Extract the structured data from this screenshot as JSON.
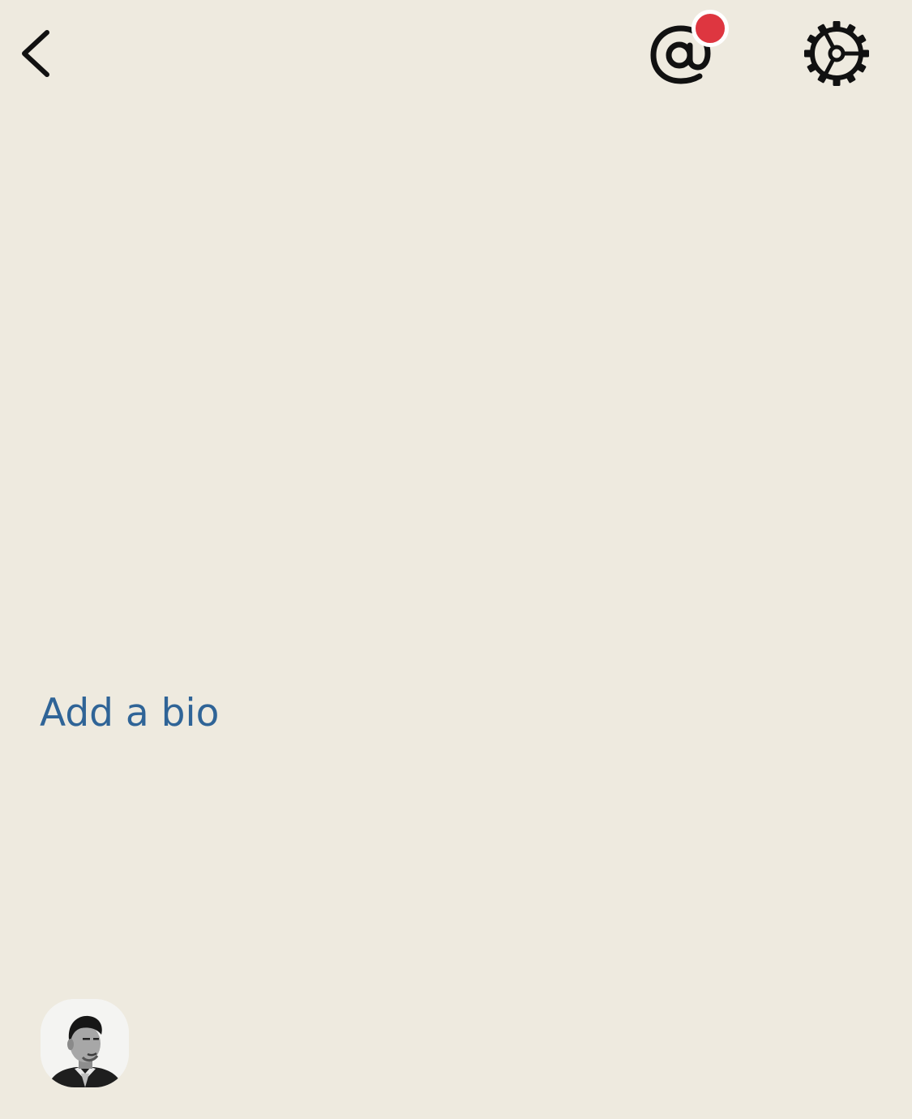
{
  "header": {
    "back_icon": "chevron-left-icon",
    "mentions_icon": "at-sign-icon",
    "mentions_has_unread": true,
    "settings_icon": "gear-icon"
  },
  "profile": {
    "bio_link_label": "Add a bio",
    "avatar": "user-avatar-photo"
  },
  "colors": {
    "background": "#EEEADF",
    "link": "#2F6497",
    "notification_dot": "#DE3640",
    "icon": "#111111"
  }
}
